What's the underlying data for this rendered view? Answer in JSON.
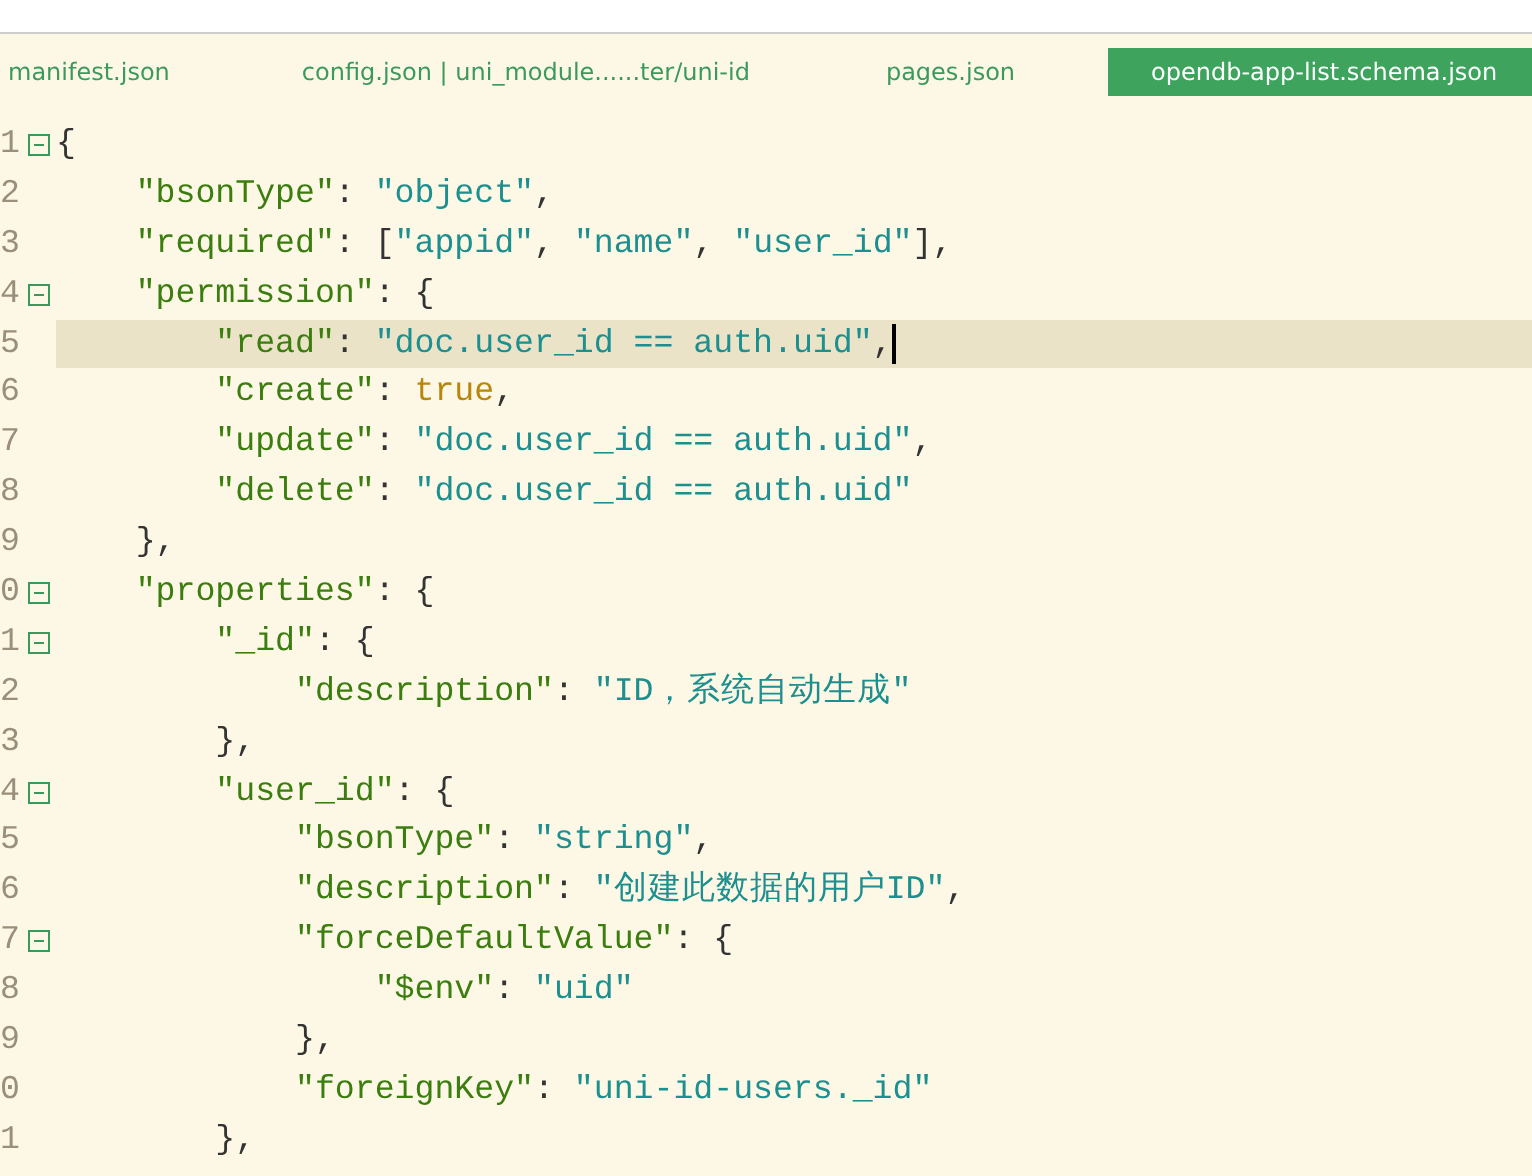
{
  "tabs": [
    {
      "label": "manifest.json",
      "selected": false
    },
    {
      "label": "config.json | uni_module......ter/uni-id",
      "selected": false
    },
    {
      "label": "pages.json",
      "selected": false
    },
    {
      "label": "opendb-app-list.schema.json",
      "selected": true
    }
  ],
  "editor": {
    "lines": [
      {
        "number": "1",
        "foldable": true,
        "highlighted": false,
        "cursor": false,
        "tokens": [
          {
            "kind": "punct",
            "text": "{"
          }
        ]
      },
      {
        "number": "2",
        "foldable": false,
        "highlighted": false,
        "cursor": false,
        "tokens": [
          {
            "kind": "key",
            "text": "    \"bsonType\""
          },
          {
            "kind": "punct",
            "text": ": "
          },
          {
            "kind": "string",
            "text": "\"object\""
          },
          {
            "kind": "punct",
            "text": ","
          }
        ]
      },
      {
        "number": "3",
        "foldable": false,
        "highlighted": false,
        "cursor": false,
        "tokens": [
          {
            "kind": "key",
            "text": "    \"required\""
          },
          {
            "kind": "punct",
            "text": ": ["
          },
          {
            "kind": "string",
            "text": "\"appid\""
          },
          {
            "kind": "punct",
            "text": ", "
          },
          {
            "kind": "string",
            "text": "\"name\""
          },
          {
            "kind": "punct",
            "text": ", "
          },
          {
            "kind": "string",
            "text": "\"user_id\""
          },
          {
            "kind": "punct",
            "text": "],"
          }
        ]
      },
      {
        "number": "4",
        "foldable": true,
        "highlighted": false,
        "cursor": false,
        "tokens": [
          {
            "kind": "key",
            "text": "    \"permission\""
          },
          {
            "kind": "punct",
            "text": ": {"
          }
        ]
      },
      {
        "number": "5",
        "foldable": false,
        "highlighted": true,
        "cursor": true,
        "tokens": [
          {
            "kind": "key",
            "text": "        \"read\""
          },
          {
            "kind": "punct",
            "text": ": "
          },
          {
            "kind": "string",
            "text": "\"doc.user_id == auth.uid\""
          },
          {
            "kind": "punct",
            "text": ","
          }
        ]
      },
      {
        "number": "6",
        "foldable": false,
        "highlighted": false,
        "cursor": false,
        "tokens": [
          {
            "kind": "key",
            "text": "        \"create\""
          },
          {
            "kind": "punct",
            "text": ": "
          },
          {
            "kind": "literal",
            "text": "true"
          },
          {
            "kind": "punct",
            "text": ","
          }
        ]
      },
      {
        "number": "7",
        "foldable": false,
        "highlighted": false,
        "cursor": false,
        "tokens": [
          {
            "kind": "key",
            "text": "        \"update\""
          },
          {
            "kind": "punct",
            "text": ": "
          },
          {
            "kind": "string",
            "text": "\"doc.user_id == auth.uid\""
          },
          {
            "kind": "punct",
            "text": ","
          }
        ]
      },
      {
        "number": "8",
        "foldable": false,
        "highlighted": false,
        "cursor": false,
        "tokens": [
          {
            "kind": "key",
            "text": "        \"delete\""
          },
          {
            "kind": "punct",
            "text": ": "
          },
          {
            "kind": "string",
            "text": "\"doc.user_id == auth.uid\""
          }
        ]
      },
      {
        "number": "9",
        "foldable": false,
        "highlighted": false,
        "cursor": false,
        "tokens": [
          {
            "kind": "punct",
            "text": "    },"
          }
        ]
      },
      {
        "number": "0",
        "foldable": true,
        "highlighted": false,
        "cursor": false,
        "tokens": [
          {
            "kind": "key",
            "text": "    \"properties\""
          },
          {
            "kind": "punct",
            "text": ": {"
          }
        ]
      },
      {
        "number": "1",
        "foldable": true,
        "highlighted": false,
        "cursor": false,
        "tokens": [
          {
            "kind": "key",
            "text": "        \"_id\""
          },
          {
            "kind": "punct",
            "text": ": {"
          }
        ]
      },
      {
        "number": "2",
        "foldable": false,
        "highlighted": false,
        "cursor": false,
        "tokens": [
          {
            "kind": "key",
            "text": "            \"description\""
          },
          {
            "kind": "punct",
            "text": ": "
          },
          {
            "kind": "string",
            "text": "\"ID，系统自动生成\""
          }
        ]
      },
      {
        "number": "3",
        "foldable": false,
        "highlighted": false,
        "cursor": false,
        "tokens": [
          {
            "kind": "punct",
            "text": "        },"
          }
        ]
      },
      {
        "number": "4",
        "foldable": true,
        "highlighted": false,
        "cursor": false,
        "tokens": [
          {
            "kind": "key",
            "text": "        \"user_id\""
          },
          {
            "kind": "punct",
            "text": ": {"
          }
        ]
      },
      {
        "number": "5",
        "foldable": false,
        "highlighted": false,
        "cursor": false,
        "tokens": [
          {
            "kind": "key",
            "text": "            \"bsonType\""
          },
          {
            "kind": "punct",
            "text": ": "
          },
          {
            "kind": "string",
            "text": "\"string\""
          },
          {
            "kind": "punct",
            "text": ","
          }
        ]
      },
      {
        "number": "6",
        "foldable": false,
        "highlighted": false,
        "cursor": false,
        "tokens": [
          {
            "kind": "key",
            "text": "            \"description\""
          },
          {
            "kind": "punct",
            "text": ": "
          },
          {
            "kind": "string",
            "text": "\"创建此数据的用户ID\""
          },
          {
            "kind": "punct",
            "text": ","
          }
        ]
      },
      {
        "number": "7",
        "foldable": true,
        "highlighted": false,
        "cursor": false,
        "tokens": [
          {
            "kind": "key",
            "text": "            \"forceDefaultValue\""
          },
          {
            "kind": "punct",
            "text": ": {"
          }
        ]
      },
      {
        "number": "8",
        "foldable": false,
        "highlighted": false,
        "cursor": false,
        "tokens": [
          {
            "kind": "key",
            "text": "                \"$env\""
          },
          {
            "kind": "punct",
            "text": ": "
          },
          {
            "kind": "string",
            "text": "\"uid\""
          }
        ]
      },
      {
        "number": "9",
        "foldable": false,
        "highlighted": false,
        "cursor": false,
        "tokens": [
          {
            "kind": "punct",
            "text": "            },"
          }
        ]
      },
      {
        "number": "0",
        "foldable": false,
        "highlighted": false,
        "cursor": false,
        "tokens": [
          {
            "kind": "key",
            "text": "            \"foreignKey\""
          },
          {
            "kind": "punct",
            "text": ": "
          },
          {
            "kind": "string",
            "text": "\"uni-id-users._id\""
          }
        ]
      },
      {
        "number": "1",
        "foldable": false,
        "highlighted": false,
        "cursor": false,
        "tokens": [
          {
            "kind": "punct",
            "text": "        },"
          }
        ]
      }
    ]
  }
}
